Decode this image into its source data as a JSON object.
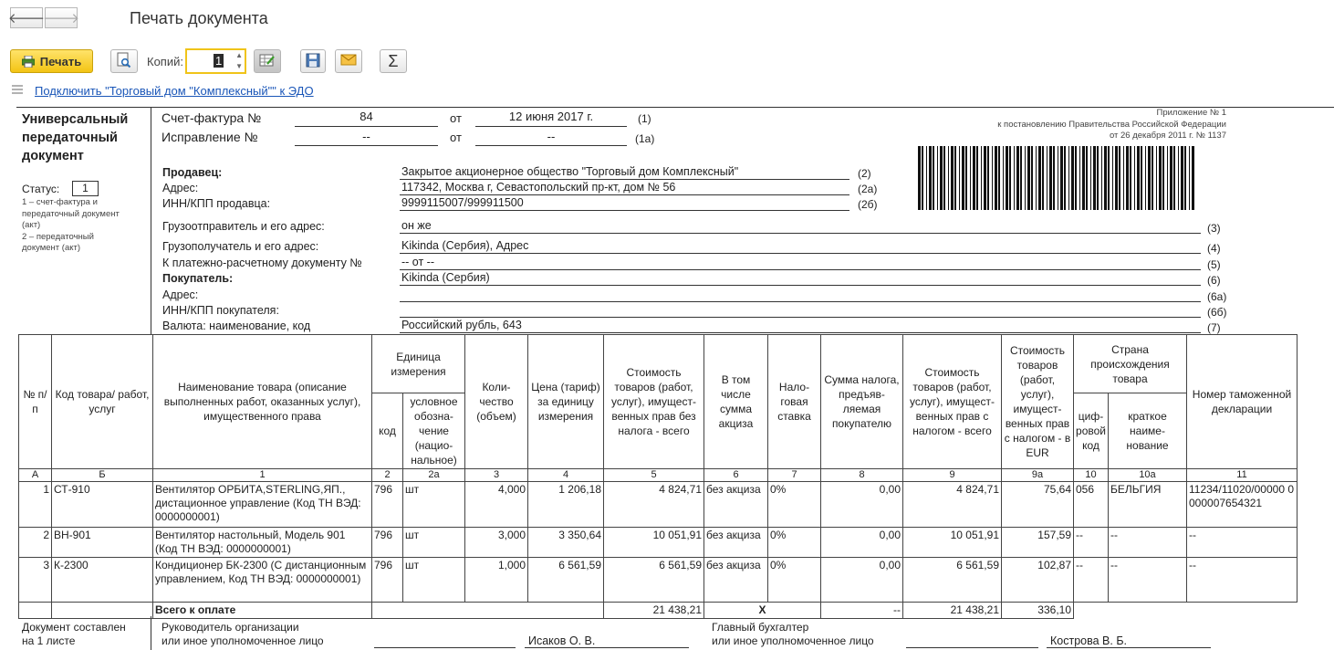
{
  "window": {
    "title": "Печать документа"
  },
  "toolbar": {
    "print_label": "Печать",
    "copies_label": "Копий:",
    "copies_value": "1"
  },
  "edo_link": "Подключить \"Торговый дом \"Комплексный\"\" к ЭДО",
  "doc": {
    "upd_title": [
      "Универсальный",
      "передаточный",
      "документ"
    ],
    "status_label": "Статус:",
    "status_value": "1",
    "status_note": [
      "1 – счет-фактура и",
      "передаточный документ",
      "(акт)",
      "2 – передаточный",
      "документ (акт)"
    ],
    "invoice_label": "Счет-фактура №",
    "invoice_no": "84",
    "from_label": "от",
    "invoice_date": "12 июня 2017 г.",
    "code_1": "(1)",
    "correction_label": "Исправление №",
    "correction_no": "--",
    "correction_date": "--",
    "code_1a": "(1а)",
    "appendix": [
      "Приложение № 1",
      "к постановлению Правительства Российской Федерации",
      "от 26 декабря 2011 г. № 1137"
    ],
    "fields": [
      {
        "label": "Продавец:",
        "value": "Закрытое акционерное общество \"Торговый дом Комплексный\"",
        "code": "(2)"
      },
      {
        "label": "Адрес:",
        "value": "117342, Москва г, Севастопольский пр-кт, дом № 56",
        "code": "(2а)"
      },
      {
        "label": "ИНН/КПП продавца:",
        "value": "9999115007/999911500",
        "code": "(2б)"
      },
      {
        "label": "Грузоотправитель и его адрес:",
        "value": "он же",
        "code": "(3)"
      },
      {
        "label": "Грузополучатель и его адрес:",
        "value": "Kikinda (Сербия), Адрес",
        "code": "(4)"
      },
      {
        "label": "К платежно-расчетному документу №",
        "value": "-- от --",
        "code": "(5)"
      },
      {
        "label": "Покупатель:",
        "value": "Kikinda (Сербия)",
        "code": "(6)"
      },
      {
        "label": "Адрес:",
        "value": "",
        "code": "(6а)"
      },
      {
        "label": "ИНН/КПП покупателя:",
        "value": "",
        "code": "(6б)"
      },
      {
        "label": "Валюта: наименование, код",
        "value": "Российский рубль, 643",
        "code": "(7)"
      }
    ],
    "table": {
      "headers": {
        "no": "№ п/п",
        "code": "Код товара/ работ, услуг",
        "name": "Наименование товара (описание выполненных работ, оказанных услуг), имущественного права",
        "unit": "Единица измерения",
        "unit_code": "код",
        "unit_sym": "условное обозна-чение (нацио-нальное)",
        "qty": "Коли-чество (объем)",
        "price": "Цена (тариф) за единицу измерения",
        "cost_wo_tax": "Стоимость товаров (работ, услуг), имущест-венных прав без налога - всего",
        "excise": "В том числе сумма акциза",
        "rate": "Нало-говая ставка",
        "tax": "Сумма налога, предъяв-ляемая покупателю",
        "cost_w_tax": "Стоимость товаров (работ, услуг), имущест-венных прав с налогом - всего",
        "cost_eur": "Стоимость товаров (работ, услуг), имущест-венных прав с налогом - в EUR",
        "country": "Страна происхождения товара",
        "country_code": "циф-ровой код",
        "country_name": "краткое наиме-нование",
        "customs": "Номер таможенной декларации"
      },
      "col_numbers": [
        "А",
        "Б",
        "1",
        "2",
        "2а",
        "3",
        "4",
        "5",
        "6",
        "7",
        "8",
        "9",
        "9а",
        "10",
        "10а",
        "11"
      ],
      "rows": [
        {
          "no": "1",
          "code": "СТ-910",
          "name": "Вентилятор ОРБИТА,STERLING,ЯП., дистационное управление (Код ТН ВЭД: 0000000001)",
          "unit_code": "796",
          "unit": "шт",
          "qty": "4,000",
          "price": "1 206,18",
          "cost": "4 824,71",
          "excise": "без акциза",
          "rate": "0%",
          "tax": "0,00",
          "total": "4 824,71",
          "eur": "75,64",
          "ccode": "056",
          "cname": "БЕЛЬГИЯ",
          "customs": "11234/11020/00000 0000007654321"
        },
        {
          "no": "2",
          "code": "ВН-901",
          "name": "Вентилятор настольный, Модель 901 (Код ТН ВЭД: 0000000001)",
          "unit_code": "796",
          "unit": "шт",
          "qty": "3,000",
          "price": "3 350,64",
          "cost": "10 051,91",
          "excise": "без акциза",
          "rate": "0%",
          "tax": "0,00",
          "total": "10 051,91",
          "eur": "157,59",
          "ccode": "--",
          "cname": "--",
          "customs": "--"
        },
        {
          "no": "3",
          "code": "К-2300",
          "name": "Кондиционер БК-2300 (С дистанционным управлением, Код ТН ВЭД: 0000000001)",
          "unit_code": "796",
          "unit": "шт",
          "qty": "1,000",
          "price": "6 561,59",
          "cost": "6 561,59",
          "excise": "без акциза",
          "rate": "0%",
          "tax": "0,00",
          "total": "6 561,59",
          "eur": "102,87",
          "ccode": "--",
          "cname": "--",
          "customs": "--"
        }
      ],
      "total": {
        "label": "Всего к оплате",
        "cost": "21 438,21",
        "excise": "X",
        "tax": "--",
        "total": "21 438,21",
        "eur": "336,10"
      }
    },
    "footer": {
      "doc_pages": [
        "Документ составлен",
        "на 1 листе"
      ],
      "head_label": [
        "Руководитель организации",
        "или иное уполномоченное лицо"
      ],
      "head_name": "Исаков О. В.",
      "acc_label": [
        "Главный бухгалтер",
        "или иное уполномоченное лицо"
      ],
      "acc_name": "Кострова В. Б."
    }
  }
}
